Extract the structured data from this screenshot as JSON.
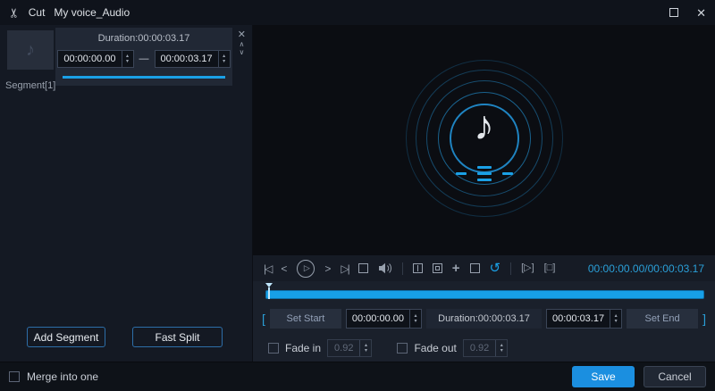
{
  "titlebar": {
    "app": "Cut",
    "file": "My voice_Audio"
  },
  "segment_panel": {
    "duration_label": "Duration:00:00:03.17",
    "start": "00:00:00.00",
    "separator": "—",
    "end": "00:00:03.17",
    "segment_label": "Segment[1]"
  },
  "left_actions": {
    "add_segment": "Add Segment",
    "fast_split": "Fast Split"
  },
  "preview": {
    "note": "♪"
  },
  "transport": {
    "time_display": "00:00:00.00/00:00:03.17"
  },
  "trim": {
    "bracket_left": "[",
    "set_start": "Set Start",
    "start": "00:00:00.00",
    "duration_label": "Duration:00:00:03.17",
    "end": "00:00:03.17",
    "set_end": "Set End",
    "bracket_right": "]"
  },
  "fade": {
    "fade_in_label": "Fade in",
    "fade_in_value": "0.92",
    "fade_out_label": "Fade out",
    "fade_out_value": "0.92"
  },
  "footer": {
    "merge_label": "Merge into one",
    "save": "Save",
    "cancel": "Cancel"
  },
  "icons": {
    "scissors": "✂",
    "close": "✕",
    "panel_close": "✕",
    "chevron_up": "∧",
    "chevron_down": "∨",
    "prev": "|◁",
    "back": "<",
    "play": "▷",
    "forward": ">",
    "next": "▷|",
    "plus": "+",
    "reset": "↺",
    "play_segment": "[▷]",
    "stop_segment": "[□]",
    "spin_up": "▴",
    "spin_down": "▾"
  },
  "colors": {
    "accent": "#1aa0e6",
    "time_text": "#2a9fd8",
    "save_button": "#1b8fe0"
  }
}
